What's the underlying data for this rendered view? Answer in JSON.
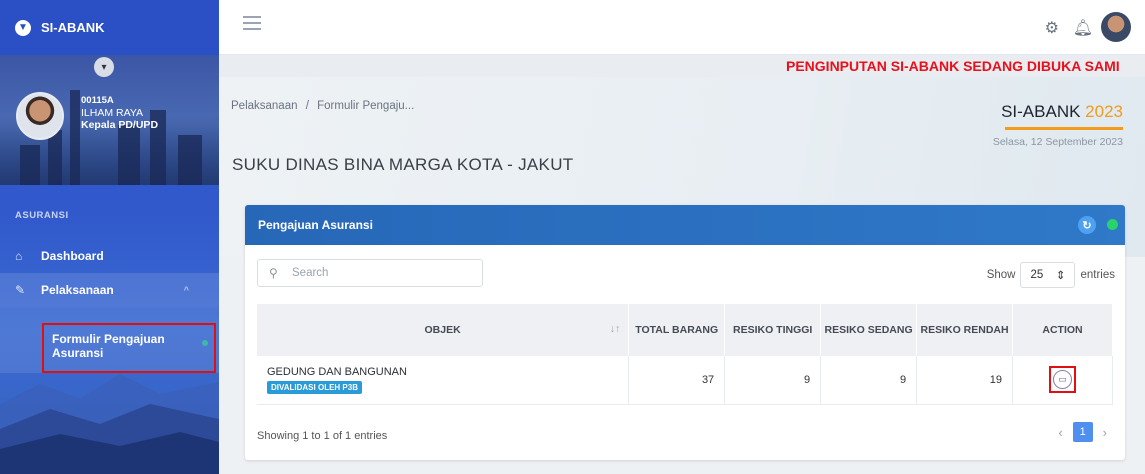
{
  "app": {
    "brand": "SI-ABANK"
  },
  "profile": {
    "id": "00115A",
    "name": "ILHAM RAYA",
    "role": "Kepala PD/UPD"
  },
  "sidebar": {
    "section": "ASURANSI",
    "items": [
      {
        "label": "Dashboard",
        "icon": "home-icon"
      },
      {
        "label": "Pelaksanaan",
        "icon": "edit-icon"
      }
    ],
    "subitem": "Formulir Pengajuan Asuransi"
  },
  "marquee": "PENGINPUTAN SI-ABANK SEDANG DIBUKA SAMI",
  "breadcrumb": {
    "root": "Pelaksanaan",
    "sep": "/",
    "current": "Formulir Pengaju..."
  },
  "page_title": "SUKU DINAS BINA MARGA KOTA - JAKUT",
  "badge": {
    "name": "SI-ABANK",
    "year": "2023",
    "date": "Selasa, 12 September 2023"
  },
  "card": {
    "title": "Pengajuan Asuransi",
    "search_placeholder": "Search",
    "show_label": "Show",
    "entries_value": "25",
    "entries_label": "entries",
    "columns": [
      "OBJEK",
      "TOTAL BARANG",
      "RESIKO TINGGI",
      "RESIKO SEDANG",
      "RESIKO RENDAH",
      "ACTION"
    ],
    "rows": [
      {
        "objek": "GEDUNG DAN BANGUNAN",
        "tag": "DIVALIDASI OLEH P3B",
        "total": "37",
        "tinggi": "9",
        "sedang": "9",
        "rendah": "19"
      }
    ],
    "footer": "Showing 1 to 1 of 1 entries",
    "page": "1"
  },
  "colors": {
    "accent": "#2f79c8",
    "warning": "#f29b1d",
    "alert": "#e8101a"
  }
}
